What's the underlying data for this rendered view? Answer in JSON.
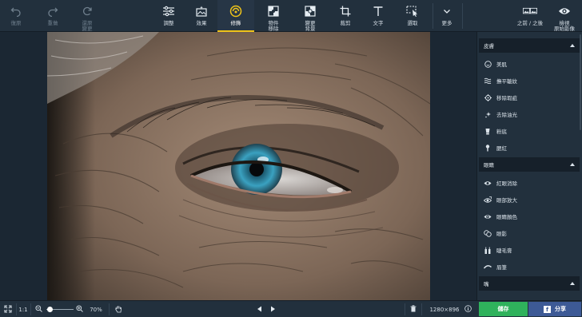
{
  "toolbar": {
    "undo": "復原",
    "redo": "重做",
    "restore": "還原\n變更",
    "adjust": "調整",
    "effects": "效果",
    "retouch": "修飾",
    "remove_object": "物件\n移除",
    "change_bg": "變更\n背景",
    "crop": "裁剪",
    "text": "文字",
    "select": "選取",
    "more": "更多",
    "before_after": "之前 / 之後",
    "view_original": "檢視\n原始影像"
  },
  "panel": {
    "skin": {
      "title": "皮膚",
      "items": [
        "美肌",
        "撫平皺紋",
        "移除瑕疵",
        "去除油光",
        "粉底",
        "腮紅"
      ]
    },
    "eyes": {
      "title": "眼睛",
      "items": [
        "紅眼消除",
        "眼部放大",
        "眼睛顏色",
        "眼影",
        "睫毛膏",
        "眉筆"
      ]
    },
    "mouth": {
      "title": "嘴"
    }
  },
  "bottombar": {
    "ratio": "1:1",
    "zoom": "70%",
    "dimensions": "1280×896",
    "save": "儲存",
    "share": "分享"
  },
  "colors": {
    "accent_active": "#f0c419",
    "save_green": "#2fb25c",
    "share_blue": "#3d5a96",
    "toolbar_bg": "#22303d"
  }
}
